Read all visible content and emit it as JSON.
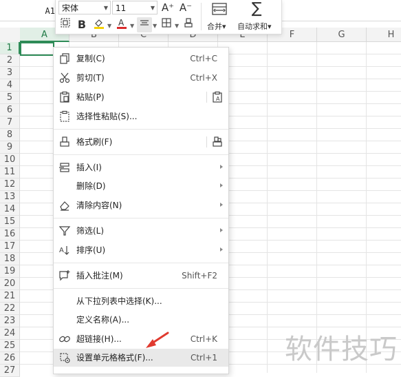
{
  "name_box": {
    "value": "A1"
  },
  "columns": [
    {
      "id": "A",
      "label": "A",
      "active": true
    },
    {
      "id": "B",
      "label": "B",
      "active": false
    },
    {
      "id": "C",
      "label": "C",
      "active": false
    },
    {
      "id": "D",
      "label": "D",
      "active": false
    },
    {
      "id": "E",
      "label": "E",
      "active": false
    },
    {
      "id": "F",
      "label": "F",
      "active": false
    },
    {
      "id": "G",
      "label": "G",
      "active": false
    },
    {
      "id": "H",
      "label": "H",
      "active": false
    }
  ],
  "rows": [
    "1",
    "2",
    "3",
    "4",
    "5",
    "6",
    "7",
    "8",
    "9",
    "10",
    "11",
    "12",
    "13",
    "14",
    "15",
    "16",
    "17",
    "18",
    "19",
    "20",
    "21",
    "22",
    "23",
    "24",
    "25",
    "26",
    "27"
  ],
  "mini_toolbar": {
    "font_name": "宋体",
    "font_size": "11",
    "increase_font_label": "A⁺",
    "decrease_font_label": "A⁻",
    "merge_label": "合并▾",
    "autosum_label": "自动求和▾",
    "font_color": "#d92b2b",
    "fill_color": "#f5d000"
  },
  "context_menu": {
    "items": [
      {
        "label": "复制(C)",
        "shortcut": "Ctrl+C",
        "icon": "copy-icon"
      },
      {
        "label": "剪切(T)",
        "shortcut": "Ctrl+X",
        "icon": "cut-icon"
      },
      {
        "label": "粘贴(P)",
        "icon": "paste-icon",
        "side_icon": "paste-text-icon"
      },
      {
        "label": "选择性粘贴(S)...",
        "icon": "paste-special-icon"
      },
      {
        "label": "格式刷(F)",
        "icon": "format-painter-icon",
        "side_icon": "format-painter-multi-icon"
      },
      {
        "label": "插入(I)",
        "icon": "insert-icon",
        "submenu": true
      },
      {
        "label": "删除(D)",
        "submenu": true
      },
      {
        "label": "清除内容(N)",
        "icon": "eraser-icon",
        "submenu": true
      },
      {
        "label": "筛选(L)",
        "icon": "filter-icon",
        "submenu": true
      },
      {
        "label": "排序(U)",
        "icon": "sort-icon",
        "submenu": true
      },
      {
        "label": "插入批注(M)",
        "shortcut": "Shift+F2",
        "icon": "comment-icon"
      },
      {
        "label": "从下拉列表中选择(K)..."
      },
      {
        "label": "定义名称(A)..."
      },
      {
        "label": "超链接(H)...",
        "shortcut": "Ctrl+K",
        "icon": "link-icon"
      },
      {
        "label": "设置单元格格式(F)...",
        "shortcut": "Ctrl+1",
        "icon": "format-cells-icon",
        "highlighted": true
      }
    ]
  },
  "watermark": {
    "text": "软件技巧"
  },
  "colors": {
    "accent": "#2e8b57",
    "annotation": "#e03a2f"
  }
}
